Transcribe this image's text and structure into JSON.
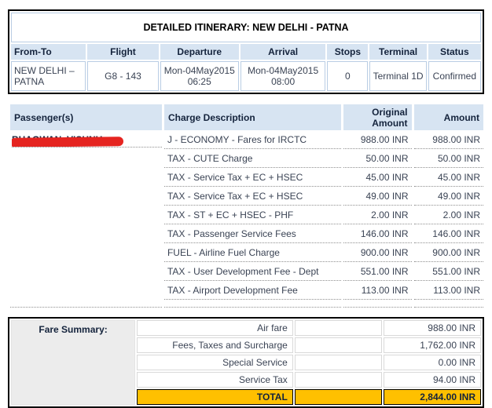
{
  "itinerary": {
    "title": "DETAILED ITINERARY: NEW DELHI - PATNA",
    "columns": [
      "From-To",
      "Flight",
      "Departure",
      "Arrival",
      "Stops",
      "Terminal",
      "Status"
    ],
    "row": {
      "from_to": "NEW DELHI – PATNA",
      "flight": "G8 - 143",
      "departure": "Mon-04May2015 06:25",
      "arrival": "Mon-04May2015 08:00",
      "stops": "0",
      "terminal": "Terminal 1D",
      "status": "Confirmed"
    }
  },
  "charges": {
    "columns": [
      "Passenger(s)",
      "Charge Description",
      "Original Amount",
      "Amount"
    ],
    "passenger_name": "BHAGWAN, VISHNU",
    "rows": [
      {
        "description": "J - ECONOMY - Fares for IRCTC",
        "original": "988.00 INR",
        "amount": "988.00 INR"
      },
      {
        "description": "TAX - CUTE Charge",
        "original": "50.00 INR",
        "amount": "50.00 INR"
      },
      {
        "description": "TAX - Service Tax + EC + HSEC",
        "original": "45.00 INR",
        "amount": "45.00 INR"
      },
      {
        "description": "TAX - Service Tax + EC + HSEC",
        "original": "49.00 INR",
        "amount": "49.00 INR"
      },
      {
        "description": "TAX - ST + EC + HSEC - PHF",
        "original": "2.00 INR",
        "amount": "2.00 INR"
      },
      {
        "description": "TAX - Passenger Service Fees",
        "original": "146.00 INR",
        "amount": "146.00 INR"
      },
      {
        "description": "FUEL - Airline Fuel Charge",
        "original": "900.00 INR",
        "amount": "900.00 INR"
      },
      {
        "description": "TAX - User Development Fee - Dept",
        "original": "551.00 INR",
        "amount": "551.00 INR"
      },
      {
        "description": "TAX - Airport Development Fee",
        "original": "113.00 INR",
        "amount": "113.00 INR"
      }
    ]
  },
  "fare_summary": {
    "label": "Fare Summary:",
    "rows": [
      {
        "label": "Air fare",
        "amount": "988.00 INR"
      },
      {
        "label": "Fees, Taxes and Surcharge",
        "amount": "1,762.00 INR"
      },
      {
        "label": "Special Service",
        "amount": "0.00 INR"
      },
      {
        "label": "Service Tax",
        "amount": "94.00 INR"
      }
    ],
    "total": {
      "label": "TOTAL",
      "amount": "2,844.00 INR"
    }
  },
  "colors": {
    "header_blue": "#d7e4f2",
    "total_yellow": "#ffc000",
    "redaction_red": "#e52420",
    "summary_gray": "#ececec",
    "border_black": "#000000"
  }
}
